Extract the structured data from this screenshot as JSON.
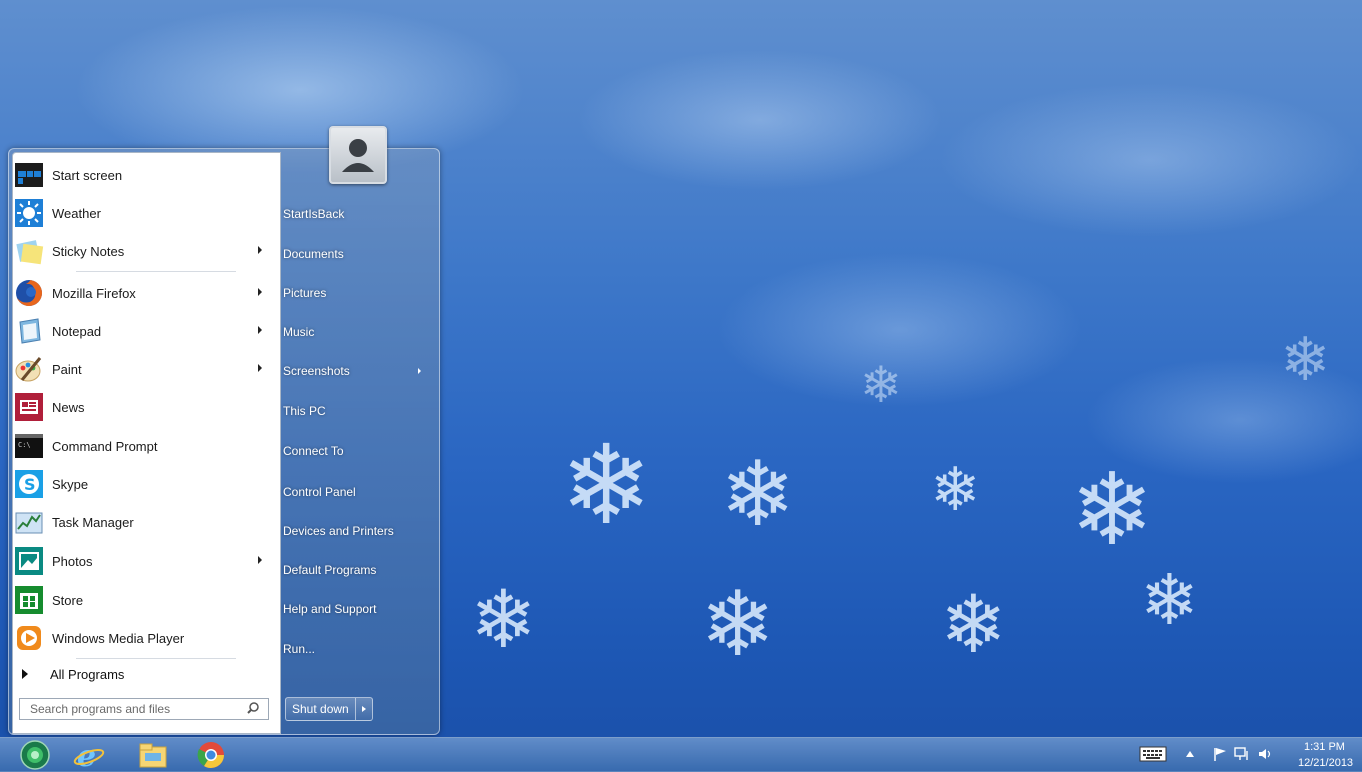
{
  "start_menu": {
    "programs": [
      {
        "label": "Start screen",
        "icon": "start-screen-icon",
        "submenu": false
      },
      {
        "label": "Weather",
        "icon": "weather-icon",
        "submenu": false
      },
      {
        "label": "Sticky Notes",
        "icon": "sticky-notes-icon",
        "submenu": true
      },
      {
        "label": "Mozilla Firefox",
        "icon": "firefox-icon",
        "submenu": true
      },
      {
        "label": "Notepad",
        "icon": "notepad-icon",
        "submenu": true
      },
      {
        "label": "Paint",
        "icon": "paint-icon",
        "submenu": true
      },
      {
        "label": "News",
        "icon": "news-icon",
        "submenu": false
      },
      {
        "label": "Command Prompt",
        "icon": "command-prompt-icon",
        "submenu": false
      },
      {
        "label": "Skype",
        "icon": "skype-icon",
        "submenu": false
      },
      {
        "label": "Task Manager",
        "icon": "task-manager-icon",
        "submenu": false
      },
      {
        "label": "Photos",
        "icon": "photos-icon",
        "submenu": true
      },
      {
        "label": "Store",
        "icon": "store-icon",
        "submenu": false
      },
      {
        "label": "Windows Media Player",
        "icon": "media-player-icon",
        "submenu": false
      }
    ],
    "all_programs": "All Programs",
    "search_placeholder": "Search programs and files",
    "places": [
      {
        "label": "StartIsBack",
        "submenu": false
      },
      {
        "label": "Documents",
        "submenu": false
      },
      {
        "label": "Pictures",
        "submenu": false
      },
      {
        "label": "Music",
        "submenu": false
      },
      {
        "label": "Screenshots",
        "submenu": true
      },
      {
        "label": "This PC",
        "submenu": false
      },
      {
        "label": "Connect To",
        "submenu": false
      },
      {
        "label": "Control Panel",
        "submenu": false
      },
      {
        "label": "Devices and Printers",
        "submenu": false
      },
      {
        "label": "Default Programs",
        "submenu": false
      },
      {
        "label": "Help and Support",
        "submenu": false
      },
      {
        "label": "Run...",
        "submenu": false
      }
    ],
    "shutdown_label": "Shut down"
  },
  "taskbar": {
    "pinned": [
      "start-orb-icon",
      "internet-explorer-icon",
      "file-explorer-icon",
      "chrome-icon"
    ],
    "tray": [
      "keyboard-icon",
      "show-hidden-icons-chevron",
      "flag-icon",
      "network-icon",
      "volume-icon"
    ],
    "clock_time": "1:31 PM",
    "clock_date": "12/21/2013"
  },
  "colors": {
    "wallpaper": "#2a66c2",
    "menu_panel": "#4e7db3",
    "accent_blue": "#1e7fd6"
  }
}
